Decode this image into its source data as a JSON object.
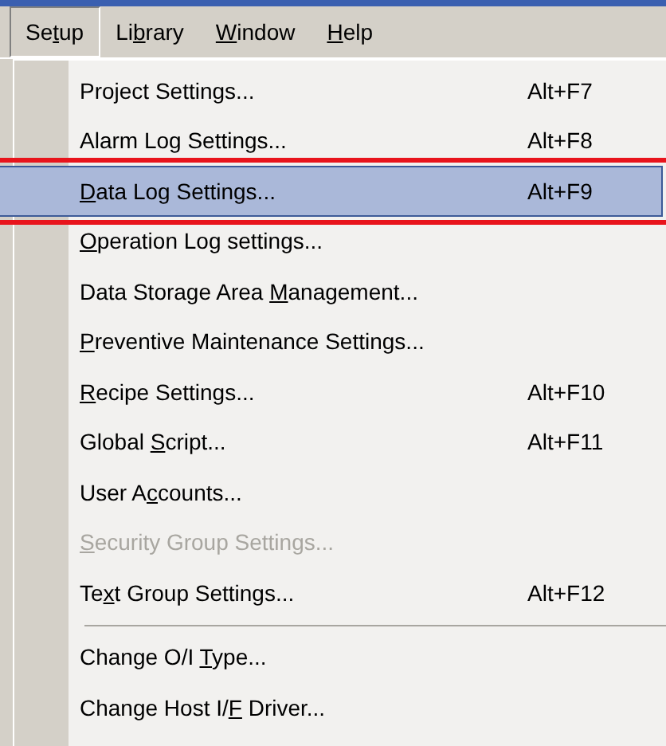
{
  "menu_bar": [
    {
      "before": "Se",
      "key": "t",
      "after": "up",
      "selected": true
    },
    {
      "before": "Li",
      "key": "b",
      "after": "rary",
      "selected": false
    },
    {
      "key": "W",
      "after": "indow",
      "selected": false
    },
    {
      "key": "H",
      "after": "elp",
      "selected": false
    }
  ],
  "menu": [
    {
      "kind": "item",
      "before": "Project Settings...",
      "shortcut": "Alt+F7",
      "selected": false,
      "disabled": false
    },
    {
      "kind": "item",
      "before": "Alarm Log Settings...",
      "shortcut": "Alt+F8",
      "selected": false,
      "disabled": false
    },
    {
      "kind": "item",
      "key": "D",
      "after": "ata Log Settings...",
      "shortcut": "Alt+F9",
      "selected": true,
      "disabled": false
    },
    {
      "kind": "item",
      "key": "O",
      "after": "peration Log settings...",
      "selected": false,
      "disabled": false
    },
    {
      "kind": "item",
      "before": "Data Storage Area ",
      "key": "M",
      "after": "anagement...",
      "selected": false,
      "disabled": false
    },
    {
      "kind": "item",
      "key": "P",
      "after": "reventive Maintenance Settings...",
      "selected": false,
      "disabled": false
    },
    {
      "kind": "item",
      "key": "R",
      "after": "ecipe Settings...",
      "shortcut": "Alt+F10",
      "selected": false,
      "disabled": false
    },
    {
      "kind": "item",
      "before": "Global ",
      "key": "S",
      "after": "cript...",
      "shortcut": "Alt+F11",
      "selected": false,
      "disabled": false
    },
    {
      "kind": "item",
      "before": "User A",
      "key": "c",
      "after": "counts...",
      "selected": false,
      "disabled": false
    },
    {
      "kind": "item",
      "key": "S",
      "after": "ecurity Group Settings...",
      "selected": false,
      "disabled": true
    },
    {
      "kind": "item",
      "before": "Te",
      "key": "x",
      "after": "t Group Settings...",
      "shortcut": "Alt+F12",
      "selected": false,
      "disabled": false
    },
    {
      "kind": "separator"
    },
    {
      "kind": "item",
      "before": "Change O/I ",
      "key": "T",
      "after": "ype...",
      "selected": false,
      "disabled": false
    },
    {
      "kind": "item",
      "before": "Change Host I/",
      "key": "F",
      "after": " Driver...",
      "selected": false,
      "disabled": false
    }
  ]
}
